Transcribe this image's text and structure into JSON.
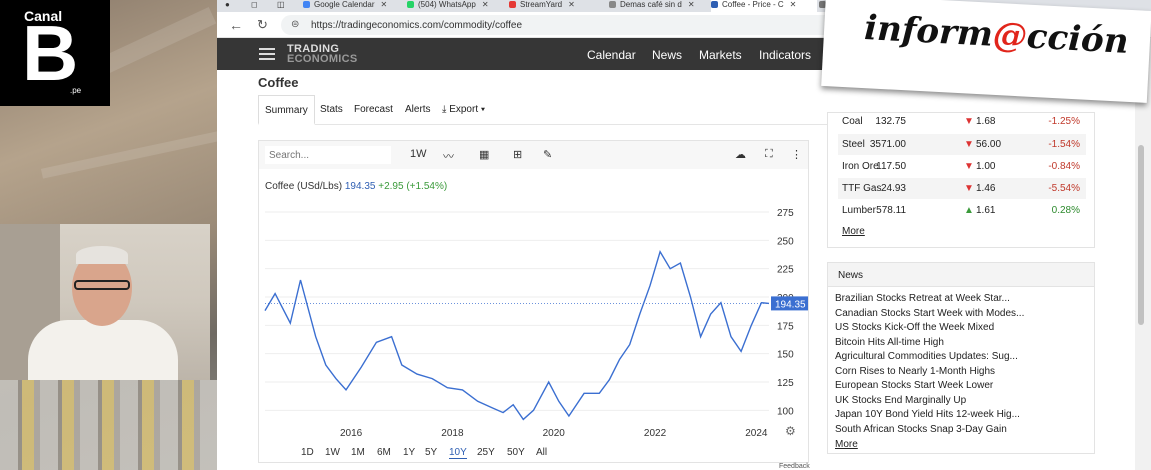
{
  "broadcast": {
    "logo_small": "Canal",
    "logo_big": "B",
    "logo_suffix": ".pe",
    "overlay_brand": "inform",
    "overlay_brand_at": "@",
    "overlay_brand_end": "cción"
  },
  "browser": {
    "tabs": [
      {
        "label": "Google Calendar",
        "icon_color": "#4285f4"
      },
      {
        "label": "(504) WhatsApp",
        "icon_color": "#25d366"
      },
      {
        "label": "StreamYard",
        "icon_color": "#e53935"
      },
      {
        "label": "Demas café sin d",
        "icon_color": "#888888"
      },
      {
        "label": "Coffee - Price - C",
        "icon_color": "#2f5fb3"
      },
      {
        "label": "S",
        "icon_color": "#777777"
      }
    ],
    "url": "https://tradingeconomics.com/commodity/coffee"
  },
  "site": {
    "brand_line1": "TRADING",
    "brand_line2": "ECONOMICS",
    "nav": [
      "Calendar",
      "News",
      "Markets",
      "Indicators"
    ],
    "page_title": "Coffee",
    "subnav": [
      "Summary",
      "Stats",
      "Forecast",
      "Alerts",
      "Export"
    ],
    "active_subnav": "Summary"
  },
  "chart_toolbar": {
    "search_placeholder": "Search...",
    "period": "1W"
  },
  "chart_data": {
    "type": "line",
    "title": "Coffee (USd/Lbs)",
    "last_value": "194.35",
    "change": "+2.95",
    "change_pct": "(+1.54%)",
    "last_value_label": "194.35",
    "x_ticks": [
      "2016",
      "2018",
      "2020",
      "2022",
      "2024"
    ],
    "y_ticks": [
      100,
      125,
      150,
      175,
      200,
      225,
      250,
      275
    ],
    "ylim": [
      80,
      290
    ],
    "xlim": [
      2014.3,
      2024.25
    ],
    "series": [
      {
        "x": [
          2014.3,
          2014.5,
          2014.8,
          2015.0,
          2015.3,
          2015.5,
          2015.7,
          2015.9,
          2016.2,
          2016.5,
          2016.8,
          2017.0,
          2017.3,
          2017.6,
          2017.9,
          2018.2,
          2018.5,
          2018.8,
          2019.0,
          2019.2,
          2019.4,
          2019.6,
          2019.9,
          2020.1,
          2020.3,
          2020.6,
          2020.9,
          2021.1,
          2021.3,
          2021.5,
          2021.7,
          2021.9,
          2022.1,
          2022.3,
          2022.5,
          2022.7,
          2022.9,
          2023.1,
          2023.3,
          2023.5,
          2023.7,
          2023.9,
          2024.1,
          2024.25
        ],
        "y": [
          188,
          203,
          177,
          215,
          165,
          140,
          128,
          118,
          138,
          160,
          165,
          140,
          132,
          128,
          120,
          118,
          108,
          102,
          98,
          105,
          92,
          100,
          125,
          108,
          95,
          115,
          115,
          127,
          145,
          158,
          185,
          210,
          240,
          225,
          230,
          200,
          165,
          185,
          195,
          165,
          152,
          175,
          195,
          194.35
        ]
      }
    ]
  },
  "ranges": [
    "1D",
    "1W",
    "1M",
    "6M",
    "1Y",
    "5Y",
    "10Y",
    "25Y",
    "50Y",
    "All"
  ],
  "active_range": "10Y",
  "feedback": "Feedback",
  "commodities": [
    {
      "name": "Coal",
      "value": "132.75",
      "dir": "down",
      "change": "1.68",
      "pct": "-1.25%"
    },
    {
      "name": "Steel",
      "value": "3571.00",
      "dir": "down",
      "change": "56.00",
      "pct": "-1.54%"
    },
    {
      "name": "Iron Ore",
      "value": "117.50",
      "dir": "down",
      "change": "1.00",
      "pct": "-0.84%"
    },
    {
      "name": "TTF Gas",
      "value": "24.93",
      "dir": "down",
      "change": "1.46",
      "pct": "-5.54%"
    },
    {
      "name": "Lumber",
      "value": "578.11",
      "dir": "up",
      "change": "1.61",
      "pct": "0.28%"
    }
  ],
  "commodities_more": "More",
  "news": {
    "title": "News",
    "items": [
      "Brazilian Stocks Retreat at Week Star...",
      "Canadian Stocks Start Week with Modes...",
      "US Stocks Kick-Off the Week Mixed",
      "Bitcoin Hits All-time High",
      "Agricultural Commodities Updates: Sug...",
      "Corn Rises to Nearly 1-Month Highs",
      "European Stocks Start Week Lower",
      "UK Stocks End Marginally Up",
      "Japan 10Y Bond Yield Hits 12-week Hig...",
      "South African Stocks Snap 3-Day Gain"
    ],
    "more": "More"
  },
  "icons": {
    "arrow_down": "▼",
    "arrow_up": "▲"
  }
}
